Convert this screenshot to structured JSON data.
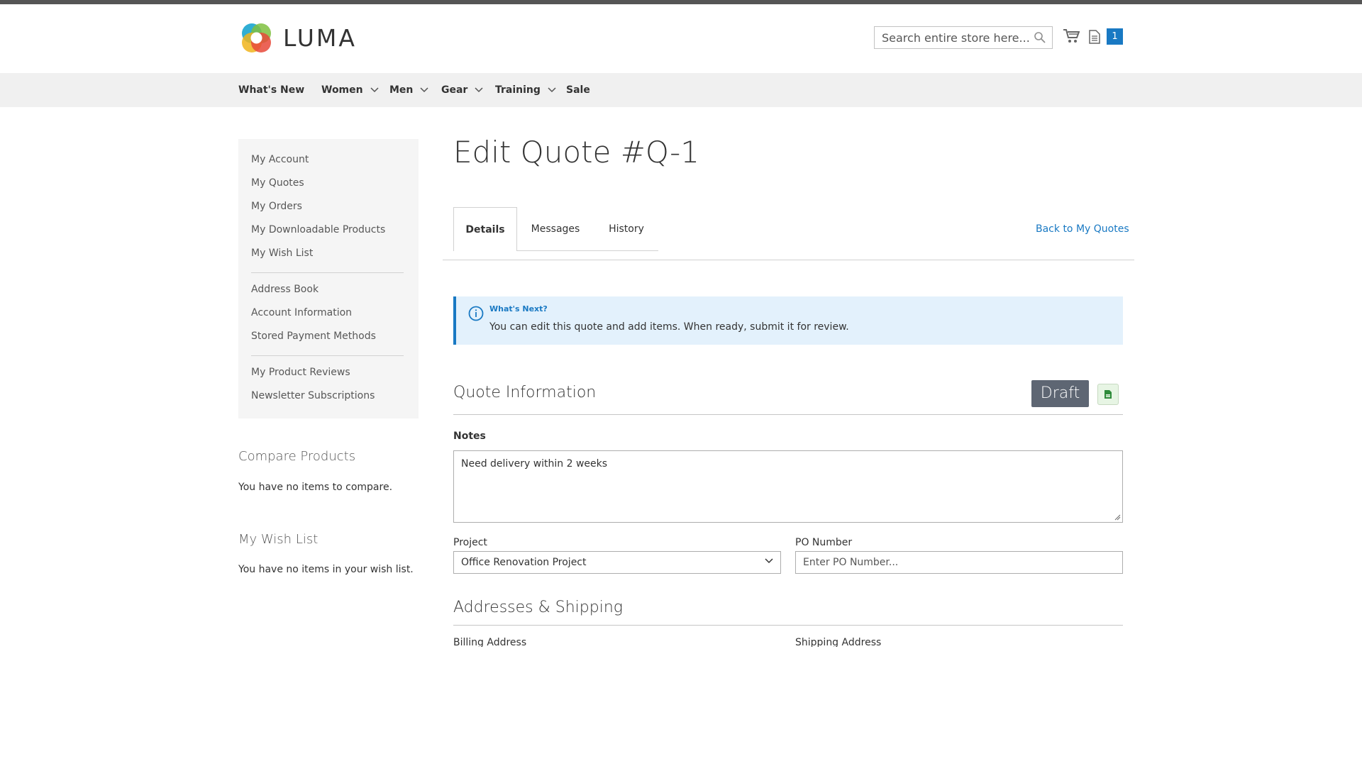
{
  "header": {
    "brand": "LUMA",
    "search_placeholder": "Search entire store here...",
    "quote_count": "1"
  },
  "nav": {
    "items": [
      {
        "label": "What's New",
        "has_dropdown": false
      },
      {
        "label": "Women",
        "has_dropdown": true
      },
      {
        "label": "Men",
        "has_dropdown": true
      },
      {
        "label": "Gear",
        "has_dropdown": true
      },
      {
        "label": "Training",
        "has_dropdown": true
      },
      {
        "label": "Sale",
        "has_dropdown": false
      }
    ]
  },
  "sidebar": {
    "group1": [
      "My Account",
      "My Quotes",
      "My Orders",
      "My Downloadable Products",
      "My Wish List"
    ],
    "group2": [
      "Address Book",
      "Account Information",
      "Stored Payment Methods"
    ],
    "group3": [
      "My Product Reviews",
      "Newsletter Subscriptions"
    ]
  },
  "compare": {
    "title": "Compare Products",
    "text": "You have no items to compare."
  },
  "wishlist": {
    "title": "My Wish List",
    "text": "You have no items in your wish list."
  },
  "main": {
    "title": "Edit Quote #Q-1",
    "tabs": [
      "Details",
      "Messages",
      "History"
    ],
    "back_link": "Back to My Quotes",
    "info": {
      "title": "What's Next?",
      "text": "You can edit this quote and add items. When ready, submit it for review."
    },
    "quote_info": {
      "title": "Quote Information",
      "status": "Draft",
      "notes_label": "Notes",
      "notes_value": "Need delivery within 2 weeks",
      "project_label": "Project",
      "project_value": "Office Renovation Project",
      "po_label": "PO Number",
      "po_placeholder": "Enter PO Number..."
    },
    "addresses": {
      "title": "Addresses & Shipping",
      "billing_label": "Billing Address",
      "shipping_label": "Shipping Address"
    }
  },
  "colors": {
    "accent": "#1979c3",
    "nav_bg": "#f0f0f0",
    "sidebar_bg": "#f5f5f5",
    "info_bg": "#e3f1fc",
    "status_badge": "#5e6673"
  }
}
